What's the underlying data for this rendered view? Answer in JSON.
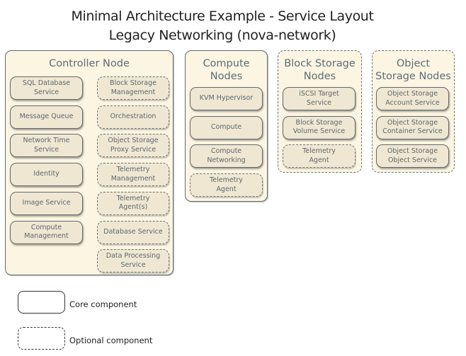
{
  "title": {
    "line1": "Minimal Architecture Example - Service Layout",
    "line2": "Legacy Networking (nova-network)"
  },
  "nodes": {
    "controller": {
      "title": "Controller Node",
      "type": "core",
      "left_column": [
        {
          "label": "SQL Database\nService",
          "type": "core"
        },
        {
          "label": "Message Queue",
          "type": "core"
        },
        {
          "label": "Network Time\nService",
          "type": "core"
        },
        {
          "label": "Identity",
          "type": "core"
        },
        {
          "label": "Image Service",
          "type": "core"
        },
        {
          "label": "Compute\nManagement",
          "type": "core"
        }
      ],
      "right_column": [
        {
          "label": "Block Storage\nManagement",
          "type": "optional"
        },
        {
          "label": "Orchestration",
          "type": "optional"
        },
        {
          "label": "Object Storage\nProxy Service",
          "type": "optional"
        },
        {
          "label": "Telemetry\nManagement",
          "type": "optional"
        },
        {
          "label": "Telemetry\nAgent(s)",
          "type": "optional"
        },
        {
          "label": "Database Service",
          "type": "optional"
        },
        {
          "label": "Data Processing\nService",
          "type": "optional"
        }
      ]
    },
    "compute": {
      "title": "Compute\nNodes",
      "type": "core",
      "components": [
        {
          "label": "KVM Hypervisor",
          "type": "core"
        },
        {
          "label": "Compute",
          "type": "core"
        },
        {
          "label": "Compute\nNetworking",
          "type": "core"
        },
        {
          "label": "Telemetry\nAgent",
          "type": "optional"
        }
      ]
    },
    "block_storage": {
      "title": "Block Storage\nNodes",
      "type": "optional",
      "components": [
        {
          "label": "iSCSI Target\nService",
          "type": "core"
        },
        {
          "label": "Block Storage\nVolume Service",
          "type": "core"
        },
        {
          "label": "Telemetry\nAgent",
          "type": "optional"
        }
      ]
    },
    "object_storage": {
      "title": "Object\nStorage Nodes",
      "type": "optional",
      "components": [
        {
          "label": "Object Storage\nAccount Service",
          "type": "core"
        },
        {
          "label": "Object Storage\nContainer Service",
          "type": "core"
        },
        {
          "label": "Object Storage\nObject Service",
          "type": "core"
        }
      ]
    }
  },
  "legend": {
    "core_label": "Core component",
    "optional_label": "Optional component"
  },
  "colors": {
    "node_fill": "#fcf5e1",
    "component_fill": "#efe7d2",
    "border": "#606b73",
    "text": "#5c6870"
  }
}
